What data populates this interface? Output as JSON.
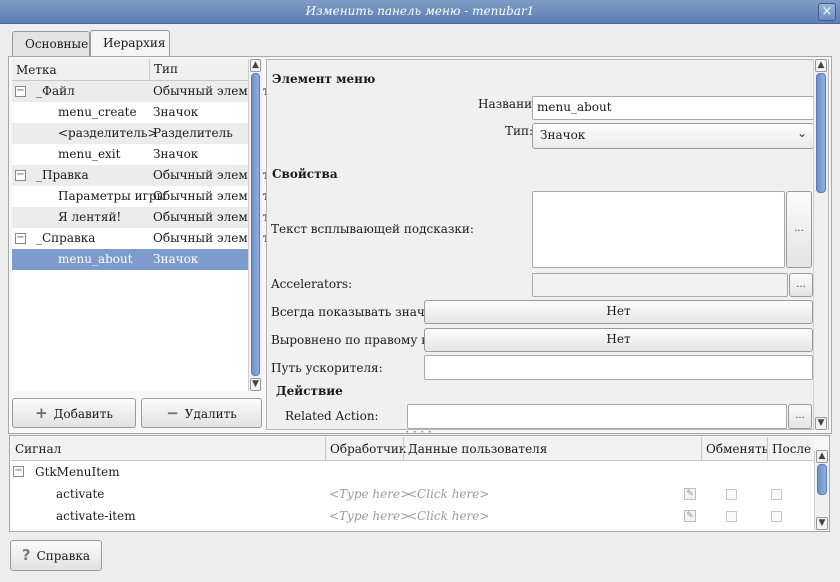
{
  "window": {
    "title": "Изменить панель меню - menubar1",
    "close_icon": "×"
  },
  "tabs": [
    {
      "label": "Основные"
    },
    {
      "label": "Иерархия"
    }
  ],
  "tree": {
    "col_label": "Метка",
    "col_type": "Тип",
    "rows": [
      {
        "label": "_Файл",
        "type": "Обычный элемент"
      },
      {
        "label": "menu_create",
        "type": "Значок"
      },
      {
        "label": "<разделитель>",
        "type": "Разделитель"
      },
      {
        "label": "menu_exit",
        "type": "Значок"
      },
      {
        "label": "_Правка",
        "type": "Обычный элемент"
      },
      {
        "label": "Параметры игры",
        "type": "Обычный элемент"
      },
      {
        "label": "Я лентяй!",
        "type": "Обычный элемент"
      },
      {
        "label": "_Справка",
        "type": "Обычный элемент"
      },
      {
        "label": "menu_about",
        "type": "Значок"
      }
    ]
  },
  "buttons": {
    "add": "Добавить",
    "remove": "Удалить",
    "help": "Справка"
  },
  "properties": {
    "section_menu_item": "Элемент меню",
    "name_label": "Название:",
    "name_value": "menu_about",
    "type_label": "Тип:",
    "type_value": "Значок",
    "section_properties": "Свойства",
    "tooltip_label": "Текст всплывающей подсказки:",
    "accelerators_label": "Accelerators:",
    "always_show_icon_label": "Всегда показывать значок:",
    "always_show_icon_value": "Нет",
    "right_justified_label": "Выровнено по правому краю:",
    "right_justified_value": "Нет",
    "accel_path_label": "Путь ускорителя:",
    "section_action": "Действие",
    "related_action_label": "Related Action:",
    "ellipsis": "..."
  },
  "signals": {
    "columns": [
      "Сигнал",
      "Обработчик",
      "Данные пользователя",
      "Обменять",
      "После"
    ],
    "group": "GtkMenuItem",
    "rows": [
      {
        "signal": "activate",
        "handler": "<Type here>",
        "user_data": "<Click here>"
      },
      {
        "signal": "activate-item",
        "handler": "<Type here>",
        "user_data": "<Click here>"
      }
    ]
  }
}
